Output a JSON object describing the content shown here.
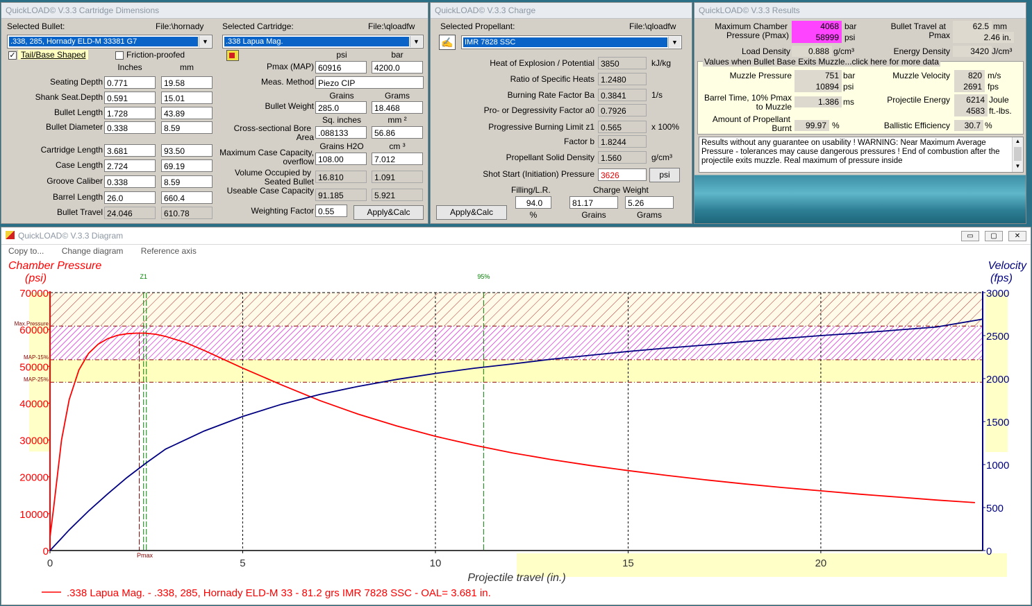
{
  "dims": {
    "title": "QuickLOAD© V.3.3 Cartridge Dimensions",
    "selected_bullet_label": "Selected Bullet:",
    "bullet_file": "File:\\hornady",
    "bullet": ".338, 285, Hornady ELD-M 33381 G7",
    "selected_cartridge_label": "Selected Cartridge:",
    "cartridge_file": "File:\\qloadfw",
    "cartridge": ".338 Lapua Mag.",
    "tail_label": "Tail/Base Shaped",
    "tail_mark": "✓",
    "friction_label": "Friction-proofed",
    "col_inches": "Inches",
    "col_mm": "mm",
    "rows": [
      {
        "label": "Seating Depth",
        "in": "0.771",
        "mm": "19.58"
      },
      {
        "label": "Shank Seat.Depth",
        "in": "0.591",
        "mm": "15.01"
      },
      {
        "label": "Bullet Length",
        "in": "1.728",
        "mm": "43.89"
      },
      {
        "label": "Bullet Diameter",
        "in": "0.338",
        "mm": "8.59"
      },
      {
        "label": "Cartridge Length",
        "in": "3.681",
        "mm": "93.50"
      },
      {
        "label": "Case Length",
        "in": "2.724",
        "mm": "69.19"
      },
      {
        "label": "Groove Caliber",
        "in": "0.338",
        "mm": "8.59"
      },
      {
        "label": "Barrel Length",
        "in": "26.0",
        "mm": "660.4"
      },
      {
        "label": "Bullet Travel",
        "in": "24.046",
        "mm": "610.78"
      }
    ],
    "col_psi": "psi",
    "col_bar": "bar",
    "pmax_label": "Pmax (MAP)",
    "pmax_psi": "60916",
    "pmax_bar": "4200.0",
    "meas_label": "Meas. Method",
    "meas_value": "Piezo CIP",
    "col_grains": "Grains",
    "col_grams": "Grams",
    "bw_label": "Bullet Weight",
    "bw_grains": "285.0",
    "bw_grams": "18.468",
    "col_sq_in": "Sq. inches",
    "col_mm2": "mm ²",
    "bore_label1": "Cross-sectional Bore",
    "bore_label2": "Area",
    "bore_in": ".088133",
    "bore_mm": "56.86",
    "col_h2o": "Grains H2O",
    "col_cm3": "cm ³",
    "mcc_label1": "Maximum Case Capacity,",
    "mcc_label2": "overflow",
    "mcc_gr": "108.00",
    "mcc_cm": "7.012",
    "vol_label1": "Volume Occupied by",
    "vol_label2": "Seated Bullet",
    "vol_gr": "16.810",
    "vol_cm": "1.091",
    "ucc_label": "Useable Case Capacity",
    "ucc_gr": "91.185",
    "ucc_cm": "5.921",
    "wf_label": "Weighting Factor",
    "wf_value": "0.55",
    "apply": "Apply&Calc"
  },
  "charge": {
    "title": "QuickLOAD© V.3.3 Charge",
    "selected_label": "Selected Propellant:",
    "file": "File:\\qloadfw",
    "propellant": "IMR 7828 SSC",
    "rows": [
      {
        "label": "Heat of Explosion / Potential",
        "value": "3850",
        "unit": "kJ/kg"
      },
      {
        "label": "Ratio of Specific Heats",
        "value": "1.2480",
        "unit": ""
      },
      {
        "label": "Burning Rate Factor  Ba",
        "value": "0.3841",
        "unit": "1/s"
      },
      {
        "label": "Pro- or Degressivity Factor  a0",
        "value": "0.7926",
        "unit": ""
      },
      {
        "label": "Progressive Burning Limit z1",
        "value": "0.565",
        "unit": "x 100%"
      },
      {
        "label": "Factor  b",
        "value": "1.8244",
        "unit": ""
      },
      {
        "label": "Propellant Solid Density",
        "value": "1.560",
        "unit": "g/cm³"
      }
    ],
    "shot_label": "Shot Start (Initiation) Pressure",
    "shot_value": "3626",
    "shot_unit": "psi",
    "filling_label": "Filling/L.R.",
    "filling_value": "94.0",
    "filling_unit": "%",
    "cw_label": "Charge Weight",
    "cw_grains": "81.17",
    "cw_grams": "5.26",
    "grains": "Grains",
    "grams": "Grams",
    "apply": "Apply&Calc"
  },
  "results": {
    "title": "QuickLOAD© V.3.3 Results",
    "mcp_label1": "Maximum Chamber",
    "mcp_label2": "Pressure (Pmax)",
    "mcp_bar": "4068",
    "mcp_psi": "58999",
    "bar": "bar",
    "psi": "psi",
    "bt_label1": "Bullet Travel at",
    "bt_label2": "Pmax",
    "bt_mm": "62.5",
    "bt_in": "2.46 in.",
    "mm": "mm",
    "ld_label": "Load Density",
    "ld_value": "0.888",
    "ld_unit": "g/cm³",
    "ed_label": "Energy Density",
    "ed_value": "3420",
    "ed_unit": "J/cm³",
    "box_title": "Values when Bullet Base Exits Muzzle...click here for more data",
    "mp_label": "Muzzle Pressure",
    "mp_bar": "751",
    "mp_psi": "10894",
    "mv_label": "Muzzle Velocity",
    "mv_ms": "820",
    "ms": "m/s",
    "mv_fps": "2691",
    "fps": "fps",
    "btime_label1": "Barrel Time, 10% Pmax",
    "btime_label2": "to Muzzle",
    "btime_value": "1.386",
    "ms_unit": "ms",
    "pe_label": "Projectile Energy",
    "pe_j": "6214",
    "joule": "Joule",
    "pe_ftlb": "4583",
    "ftlb": "ft.-lbs.",
    "amt_label1": "Amount of Propellant",
    "amt_label2": "Burnt",
    "amt_value": "99.97",
    "pct": "%",
    "be_label": "Ballistic Efficiency",
    "be_value": "30.7",
    "warning": "Results without any guarantee on usability !  WARNING: Near Maximum Average Pressure - tolerances may cause dangerous pressures !  End of combustion after the projectile exits muzzle.  Real maximum of pressure inside"
  },
  "diagram": {
    "title": "QuickLOAD© V.3.3 Diagram",
    "menu": [
      "Copy to...",
      "Change diagram",
      "Reference axis"
    ],
    "min": "▭",
    "max": "▢",
    "close": "✕",
    "left_axis_title": "Chamber Pressure",
    "left_axis_unit": "(psi)",
    "right_axis_title": "Velocity",
    "right_axis_unit": "(fps)",
    "xlabel": "Projectile travel (in.)",
    "legend": ".338 Lapua Mag. - .338, 285, Hornady ELD-M 33 - 81.2 grs IMR 7828 SSC - OAL= 3.681 in.",
    "colors": {
      "pressure": "#ff0000",
      "velocity": "#000080",
      "green": "#008000",
      "maroon": "#8b0000",
      "yellow": "#ffffc8",
      "hatch_red": "#b03030",
      "hatch_mag": "#d000d0"
    }
  },
  "chart_data": {
    "type": "line",
    "xlabel": "Projectile travel (in.)",
    "ylabel": "Chamber Pressure (psi)",
    "y2label": "Velocity (fps)",
    "xlim": [
      0,
      24.2
    ],
    "ylim": [
      0,
      70000
    ],
    "y2lim": [
      0,
      3000
    ],
    "xticks": [
      0,
      5,
      10,
      15,
      20
    ],
    "yticks": [
      0,
      10000,
      20000,
      30000,
      40000,
      50000,
      60000,
      70000
    ],
    "y2ticks": [
      0,
      500,
      1000,
      1500,
      2000,
      2500,
      3000
    ],
    "ref_lines": [
      {
        "label": "Max.Pressure",
        "y": 60916
      },
      {
        "label": "MAP-15%",
        "y": 51779
      },
      {
        "label": "MAP-25%",
        "y": 45687
      }
    ],
    "vlines": [
      {
        "label": "Z1",
        "x": 2.5
      },
      {
        "label": "95%",
        "x": 11.25
      },
      {
        "label": "Pmax",
        "x": 2.46
      }
    ],
    "series": [
      {
        "name": "Chamber Pressure",
        "axis": "left",
        "x": [
          0,
          0.1,
          0.3,
          0.5,
          0.75,
          1.0,
          1.25,
          1.5,
          1.75,
          2.0,
          2.25,
          2.46,
          2.75,
          3.0,
          3.5,
          4.0,
          5.0,
          6.0,
          7.0,
          8.0,
          9.0,
          10.0,
          11.0,
          12.0,
          13.0,
          14.0,
          15.0,
          16.0,
          17.0,
          18.0,
          19.0,
          20.0,
          21.0,
          22.0,
          23.0,
          24.0
        ],
        "values": [
          3626,
          12000,
          30000,
          41000,
          49000,
          53500,
          56000,
          57500,
          58400,
          58850,
          59000,
          58999,
          58700,
          58100,
          56500,
          54300,
          49500,
          45000,
          40700,
          37000,
          33800,
          31000,
          28600,
          26500,
          24700,
          23100,
          21700,
          20400,
          19200,
          18100,
          17100,
          16200,
          15300,
          14500,
          13700,
          13000
        ]
      },
      {
        "name": "Velocity",
        "axis": "right",
        "x": [
          0,
          0.25,
          0.5,
          1.0,
          1.5,
          2.0,
          2.5,
          3.0,
          4.0,
          5.0,
          6.0,
          7.0,
          8.0,
          9.0,
          10.0,
          11.0,
          12.0,
          13.0,
          14.0,
          15.0,
          16.0,
          17.0,
          18.0,
          19.0,
          20.0,
          21.0,
          22.0,
          23.0,
          24.2
        ],
        "values": [
          0,
          120,
          240,
          460,
          660,
          850,
          1020,
          1180,
          1390,
          1560,
          1700,
          1815,
          1910,
          1990,
          2060,
          2120,
          2170,
          2225,
          2270,
          2315,
          2355,
          2390,
          2430,
          2465,
          2500,
          2530,
          2565,
          2600,
          2691
        ]
      }
    ]
  }
}
